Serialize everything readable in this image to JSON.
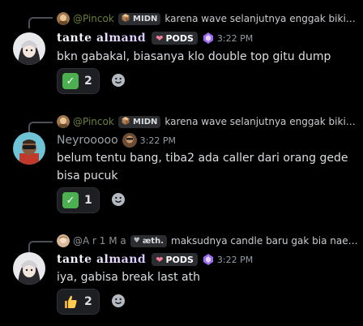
{
  "messages": [
    {
      "reply": {
        "name": "@Pincok",
        "tag": "MIDN",
        "text": "karena wave selanjutnya enggak bikin ..."
      },
      "author": "tante almand",
      "author_tag": "PODS",
      "time": "3:22 PM",
      "text": "bkn gabakal, biasanya klo double top gitu dump",
      "reaction": {
        "icon": "check-mark-emoji",
        "count": "2"
      }
    },
    {
      "reply": {
        "name": "@Pincok",
        "tag": "MIDN",
        "text": "karena wave selanjutnya enggak bikin ..."
      },
      "author": "Neyrooooo",
      "time": "3:22 PM",
      "text": "belum tentu bang, tiba2 ada caller dari orang gede bisa pucuk",
      "reaction": {
        "icon": "check-mark-emoji",
        "count": "1"
      }
    },
    {
      "reply": {
        "name": "@A r 1 M a",
        "tag": "æth.",
        "text": "maksudnya candle baru gak bia naek ..."
      },
      "author": "tante almand",
      "author_tag": "PODS",
      "time": "3:22 PM",
      "text": "iya, gabisa break last ath",
      "reaction": {
        "icon": "thumbs-up-emoji",
        "count": "2"
      }
    }
  ],
  "colors": {
    "background": "#000000",
    "pincok_name": "#6e7f3a",
    "check": "#4caf50",
    "pods_heart": "#f47b94"
  }
}
